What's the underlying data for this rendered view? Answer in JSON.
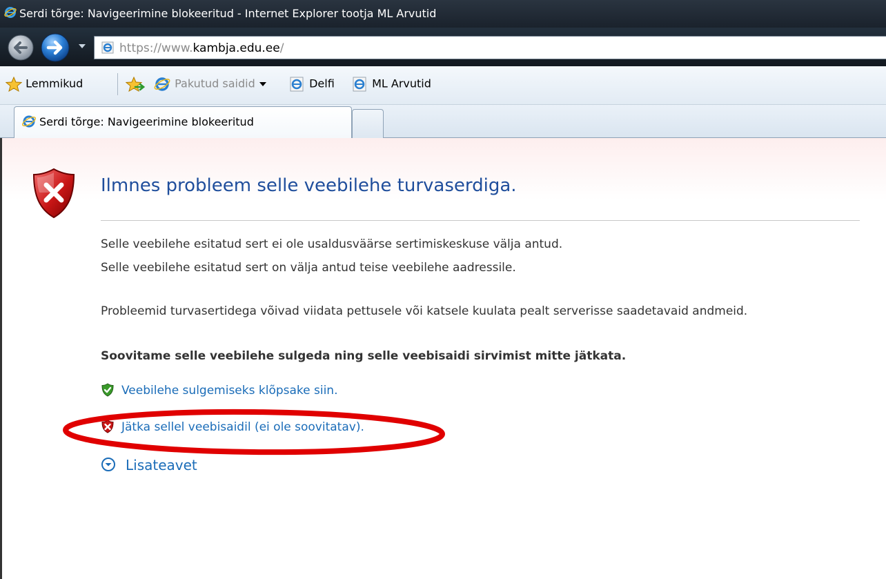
{
  "window": {
    "title": "Serdi tõrge: Navigeerimine blokeeritud - Internet Explorer tootja ML Arvutid"
  },
  "navigation": {
    "back_icon": "back-arrow-icon",
    "forward_icon": "forward-arrow-icon",
    "url_prefix": "https://www.",
    "url_host": "kambja.edu.ee",
    "url_suffix": "/"
  },
  "favorites": {
    "favorites_label": "Lemmikud",
    "suggested_sites_label": "Pakutud saidid",
    "links": [
      "Delfi",
      "ML Arvutid"
    ]
  },
  "tabs": [
    {
      "label": "Serdi tõrge: Navigeerimine blokeeritud"
    }
  ],
  "page": {
    "heading": "Ilmnes probleem selle veebilehe turvaserdiga.",
    "lines": [
      "Selle veebilehe esitatud sert ei ole usaldusväärse sertimiskeskuse välja antud.",
      "Selle veebilehe esitatud sert on välja antud teise veebilehe aadressile."
    ],
    "warning": "Probleemid turvasertidega võivad viidata pettusele või katsele kuulata pealt serverisse saadetavaid andmeid.",
    "recommendation": "Soovitame selle veebilehe sulgeda ning selle veebisaidi sirvimist mitte jätkata.",
    "close_link": "Veebilehe sulgemiseks klõpsake siin.",
    "continue_link": "Jätka sellel veebisaidil (ei ole soovitatav).",
    "more_info": "Lisateavet"
  },
  "colors": {
    "heading": "#1f4e9c",
    "link": "#1a6cb8",
    "annotation": "#e00000"
  }
}
